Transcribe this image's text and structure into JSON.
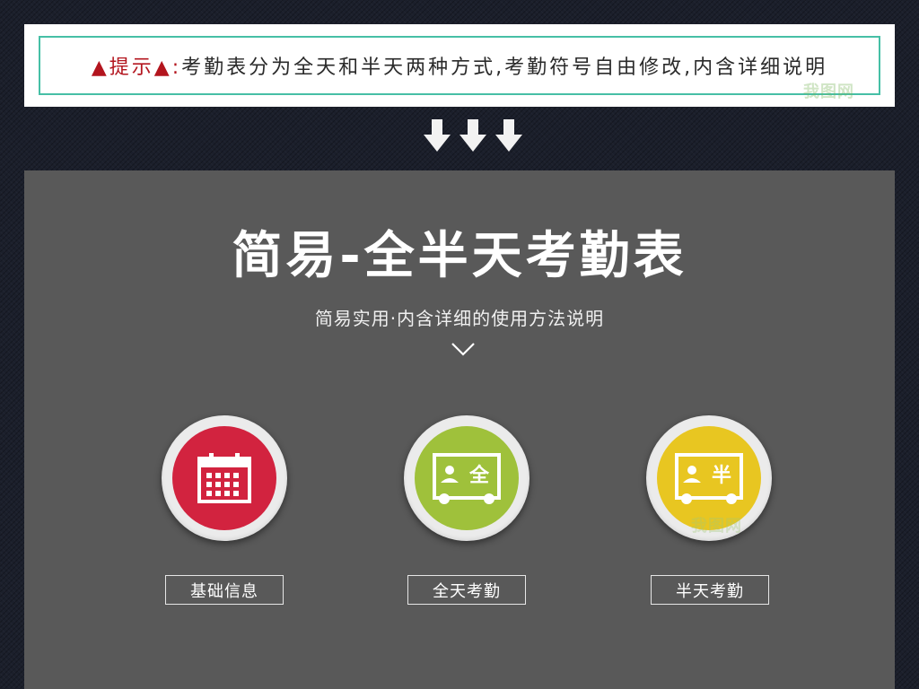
{
  "notice": {
    "prefix": "▲提示▲:",
    "text": "考勤表分为全天和半天两种方式,考勤符号自由修改,内含详细说明"
  },
  "watermark": {
    "top": "我图网",
    "middle": "我图网"
  },
  "hero": {
    "title": "简易-全半天考勤表",
    "subtitle": "简易实用·内含详细的使用方法说明"
  },
  "features": [
    {
      "label": "基础信息",
      "icon": "calendar-icon",
      "color": "#d2233f"
    },
    {
      "label": "全天考勤",
      "icon": "id-card-full-icon",
      "color": "#9fc13b",
      "badge": "全"
    },
    {
      "label": "半天考勤",
      "icon": "id-card-half-icon",
      "color": "#e8c621",
      "badge": "半"
    }
  ],
  "colors": {
    "background": "#1b1f2b",
    "panel": "#595959",
    "notice_accent": "#b3151e",
    "notice_border": "#46bfa6"
  }
}
